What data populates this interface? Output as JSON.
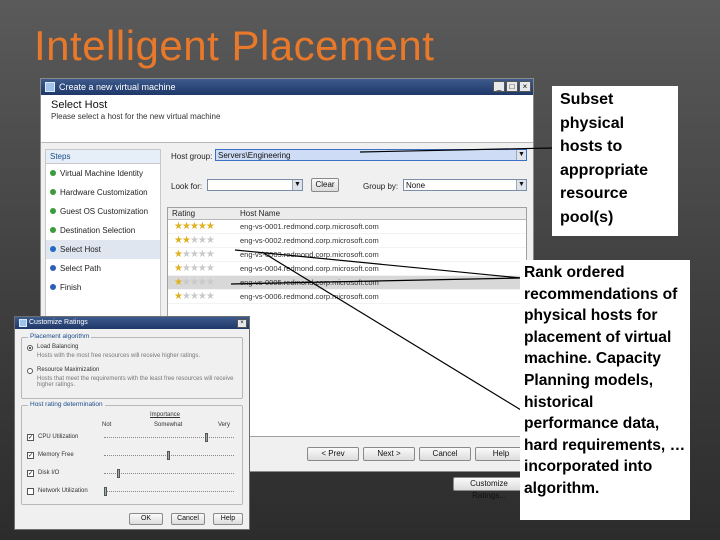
{
  "slide": {
    "title": "Intelligent Placement"
  },
  "window": {
    "title": "Create a new virtual machine",
    "header_title": "Select Host",
    "header_subtitle": "Please select a host for the new virtual machine"
  },
  "steps": {
    "label": "Steps",
    "items": [
      {
        "label": "Virtual Machine Identity"
      },
      {
        "label": "Hardware Customization"
      },
      {
        "label": "Guest OS Customization"
      },
      {
        "label": "Destination Selection"
      },
      {
        "label": "Select Host"
      },
      {
        "label": "Select Path"
      },
      {
        "label": "Finish"
      }
    ]
  },
  "host_group": {
    "label": "Host group:",
    "value": "Servers\\Engineering"
  },
  "filter": {
    "look_for_label": "Look for:",
    "look_for_value": "",
    "clear_label": "Clear",
    "group_by_label": "Group by:",
    "group_by_value": "None"
  },
  "table": {
    "col_rating": "Rating",
    "col_host": "Host Name",
    "rows": [
      {
        "stars": 5,
        "host": "eng-vs-0001.redmond.corp.microsoft.com"
      },
      {
        "stars": 2,
        "host": "eng-vs-0002.redmond.corp.microsoft.com"
      },
      {
        "stars": 1,
        "host": "eng-vs-0003.redmond.corp.microsoft.com"
      },
      {
        "stars": 1,
        "host": "eng-vs-0004.redmond.corp.microsoft.com"
      },
      {
        "stars": 1,
        "host": "eng-vs-0005.redmond.corp.microsoft.com"
      },
      {
        "stars": 1,
        "host": "eng-vs-0006.redmond.corp.microsoft.com"
      }
    ]
  },
  "buttons": {
    "customize": "Customize Ratings...",
    "previous": "< Prev",
    "next": "Next >",
    "cancel": "Cancel",
    "help": "Help"
  },
  "dialog": {
    "title": "Customize Ratings",
    "placement_group": "Placement algorithm",
    "load_balancing": "Load Balancing",
    "load_balancing_desc": "Hosts with the most free resources will receive higher ratings.",
    "resource_max": "Resource Maximization",
    "resource_max_desc": "Hosts that meet the requirements with the least free resources will receive higher ratings.",
    "resource_group": "Host rating determination",
    "importance": "Importance",
    "col_not": "Not",
    "col_somewhat": "Somewhat",
    "col_very": "Very",
    "resources": [
      {
        "label": "CPU Utilization",
        "checked": true,
        "level": 0.8
      },
      {
        "label": "Memory Free",
        "checked": true,
        "level": 0.5
      },
      {
        "label": "Disk I/O",
        "checked": true,
        "level": 0.1
      },
      {
        "label": "Network Utilization",
        "checked": false,
        "level": 0.0
      }
    ],
    "ok": "OK",
    "cancel": "Cancel",
    "help": "Help"
  },
  "callouts": {
    "top": "Subset physical hosts to appropriate resource pool(s)",
    "bottom": "Rank ordered recommendations of physical hosts for placement of virtual machine. Capacity Planning models, historical performance data, hard requirements, … incorporated into algorithm."
  },
  "colors": {
    "title_orange": "#e8782a",
    "star": "#e0b020"
  }
}
